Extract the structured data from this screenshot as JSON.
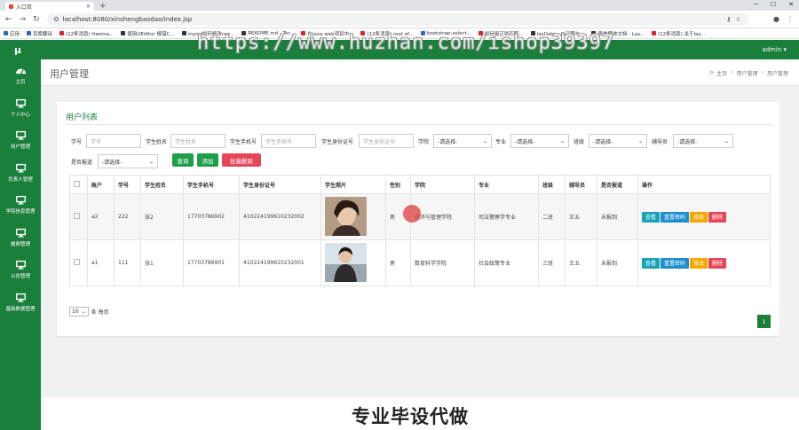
{
  "browser": {
    "tab_title": "入口页",
    "url": "localhost:8080/xinshengbaodao/index.jsp",
    "bookmarks": [
      "应用",
      "百度翻译",
      "(12条消息) freema...",
      "使用UEditor 报错C...",
      "mysql如何修改roo...",
      "README.md - Ter...",
      "在java web项目中...",
      "(12条消息) root of...",
      "bootstrap-select...",
      "如何用正则匹配...",
      "layDate - JS日期与...",
      "表单模块文档 - Lay...",
      "(12条消息) 关于lay..."
    ]
  },
  "watermark": "https://www.huzhan.com/ishop39397",
  "app": {
    "logo": "μ",
    "admin": "admin ▾",
    "sidebar": [
      {
        "label": "主页",
        "icon": "dashboard-icon"
      },
      {
        "label": "个人中心",
        "icon": "monitor-icon"
      },
      {
        "label": "用户管理",
        "icon": "monitor-icon"
      },
      {
        "label": "负责人管理",
        "icon": "monitor-icon"
      },
      {
        "label": "学院信息管理",
        "icon": "monitor-icon"
      },
      {
        "label": "缴费管理",
        "icon": "monitor-icon"
      },
      {
        "label": "公告管理",
        "icon": "monitor-icon"
      },
      {
        "label": "基础数据管理",
        "icon": "monitor-icon"
      }
    ]
  },
  "page": {
    "title": "用户管理",
    "breadcrumb": [
      "主页",
      "用户管理",
      "用户管理"
    ]
  },
  "card": {
    "title": "用户列表",
    "filters": {
      "student_no_label": "学号",
      "student_no_placeholder": "学号",
      "name_label": "学生姓名",
      "name_placeholder": "学生姓名",
      "phone_label": "学生手机号",
      "phone_placeholder": "学生手机号",
      "idcard_label": "学生身份证号",
      "idcard_placeholder": "学生身份证号",
      "college_label": "学院",
      "college_value": "-请选择-",
      "major_label": "专业",
      "major_value": "-请选择-",
      "class_label": "班级",
      "class_value": "-请选择-",
      "counselor_label": "辅导员",
      "counselor_value": "-请选择-",
      "checkin_label": "是否报道",
      "checkin_value": "-请选择-"
    },
    "buttons": {
      "search": "查询",
      "add": "添加",
      "batch_delete": "批量删除"
    },
    "columns": [
      "账户",
      "学号",
      "学生姓名",
      "学生手机号",
      "学生身份证号",
      "学生照片",
      "性别",
      "学院",
      "专业",
      "班级",
      "辅导员",
      "是否报道",
      "操作"
    ],
    "rows": [
      {
        "account": "a2",
        "no": "222",
        "name": "张2",
        "phone": "17703786902",
        "idcard": "410224199610232002",
        "gender": "男",
        "college": "经济与管理学院",
        "major": "司法警察学专业",
        "class": "二班",
        "counselor": "王五",
        "checkin": "未报到"
      },
      {
        "account": "a1",
        "no": "111",
        "name": "张1",
        "phone": "17703786901",
        "idcard": "410224199610232001",
        "gender": "男",
        "college": "数育科学学院",
        "major": "社会政策专业",
        "class": "三班",
        "counselor": "王五",
        "checkin": "未报到"
      }
    ],
    "row_actions": {
      "view": "查看",
      "reset": "重置密码",
      "edit": "修改",
      "delete": "删除"
    },
    "page_size": "10",
    "page_size_suffix": "条 每页",
    "current_page": "1"
  },
  "footer_text": "专业毕设代做",
  "colors": {
    "primary": "#1b7f3c",
    "danger": "#e6465a",
    "info": "#17a2b8",
    "warning": "#f4a800"
  }
}
